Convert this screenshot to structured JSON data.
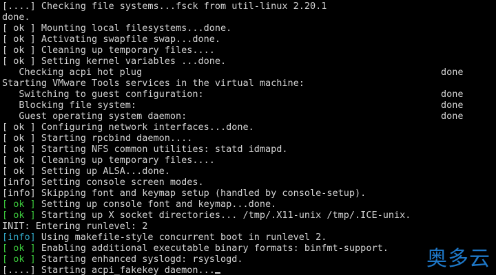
{
  "terminal": {
    "lines": [
      {
        "prefix": "[....]",
        "prefix_style": "plain",
        "text": " Checking file systems...fsck from util-linux 2.20.1"
      },
      {
        "prefix": "",
        "prefix_style": "plain",
        "text": "done."
      },
      {
        "prefix": "[ ok ]",
        "prefix_style": "plain",
        "text": " Mounting local filesystems...done."
      },
      {
        "prefix": "[ ok ]",
        "prefix_style": "plain",
        "text": " Activating swapfile swap...done."
      },
      {
        "prefix": "[ ok ]",
        "prefix_style": "plain",
        "text": " Cleaning up temporary files...."
      },
      {
        "prefix": "[ ok ]",
        "prefix_style": "plain",
        "text": " Setting kernel variables ...done."
      },
      {
        "prefix": "",
        "prefix_style": "plain",
        "text": "   Checking acpi hot plug",
        "right": "done"
      },
      {
        "prefix": "",
        "prefix_style": "plain",
        "text": "Starting VMware Tools services in the virtual machine:"
      },
      {
        "prefix": "",
        "prefix_style": "plain",
        "text": "   Switching to guest configuration:",
        "right": "done"
      },
      {
        "prefix": "",
        "prefix_style": "plain",
        "text": "   Blocking file system:",
        "right": "done"
      },
      {
        "prefix": "",
        "prefix_style": "plain",
        "text": "   Guest operating system daemon:",
        "right": "done"
      },
      {
        "prefix": "[ ok ]",
        "prefix_style": "plain",
        "text": " Configuring network interfaces...done."
      },
      {
        "prefix": "[ ok ]",
        "prefix_style": "plain",
        "text": " Starting rpcbind daemon...."
      },
      {
        "prefix": "[ ok ]",
        "prefix_style": "plain",
        "text": " Starting NFS common utilities: statd idmapd."
      },
      {
        "prefix": "[ ok ]",
        "prefix_style": "plain",
        "text": " Cleaning up temporary files...."
      },
      {
        "prefix": "[ ok ]",
        "prefix_style": "plain",
        "text": " Setting up ALSA...done."
      },
      {
        "prefix": "[info]",
        "prefix_style": "plain",
        "text": " Setting console screen modes."
      },
      {
        "prefix": "[info]",
        "prefix_style": "plain",
        "text": " Skipping font and keymap setup (handled by console-setup)."
      },
      {
        "prefix": "[ ok ]",
        "prefix_style": "green",
        "text": " Setting up console font and keymap...done."
      },
      {
        "prefix": "[ ok ]",
        "prefix_style": "green",
        "text": " Starting up X socket directories... /tmp/.X11-unix /tmp/.ICE-unix."
      },
      {
        "prefix": "",
        "prefix_style": "plain",
        "text": "INIT: Entering runlevel: 2"
      },
      {
        "prefix": "[info]",
        "prefix_style": "cyan",
        "text": " Using makefile-style concurrent boot in runlevel 2."
      },
      {
        "prefix": "[ ok ]",
        "prefix_style": "green",
        "text": " Enabling additional executable binary formats: binfmt-support."
      },
      {
        "prefix": "[ ok ]",
        "prefix_style": "green",
        "text": " Starting enhanced syslogd: rsyslogd."
      },
      {
        "prefix": "[....]",
        "prefix_style": "plain",
        "text": " Starting acpi_fakekey daemon...",
        "cursor": true
      }
    ]
  },
  "watermark": {
    "text": "奥多云"
  },
  "colors": {
    "background": "#000000",
    "foreground": "#d3d3d3",
    "ok_green": "#3dcc3d",
    "info_cyan": "#32a8c8",
    "watermark_blue": "#1e78c8"
  }
}
